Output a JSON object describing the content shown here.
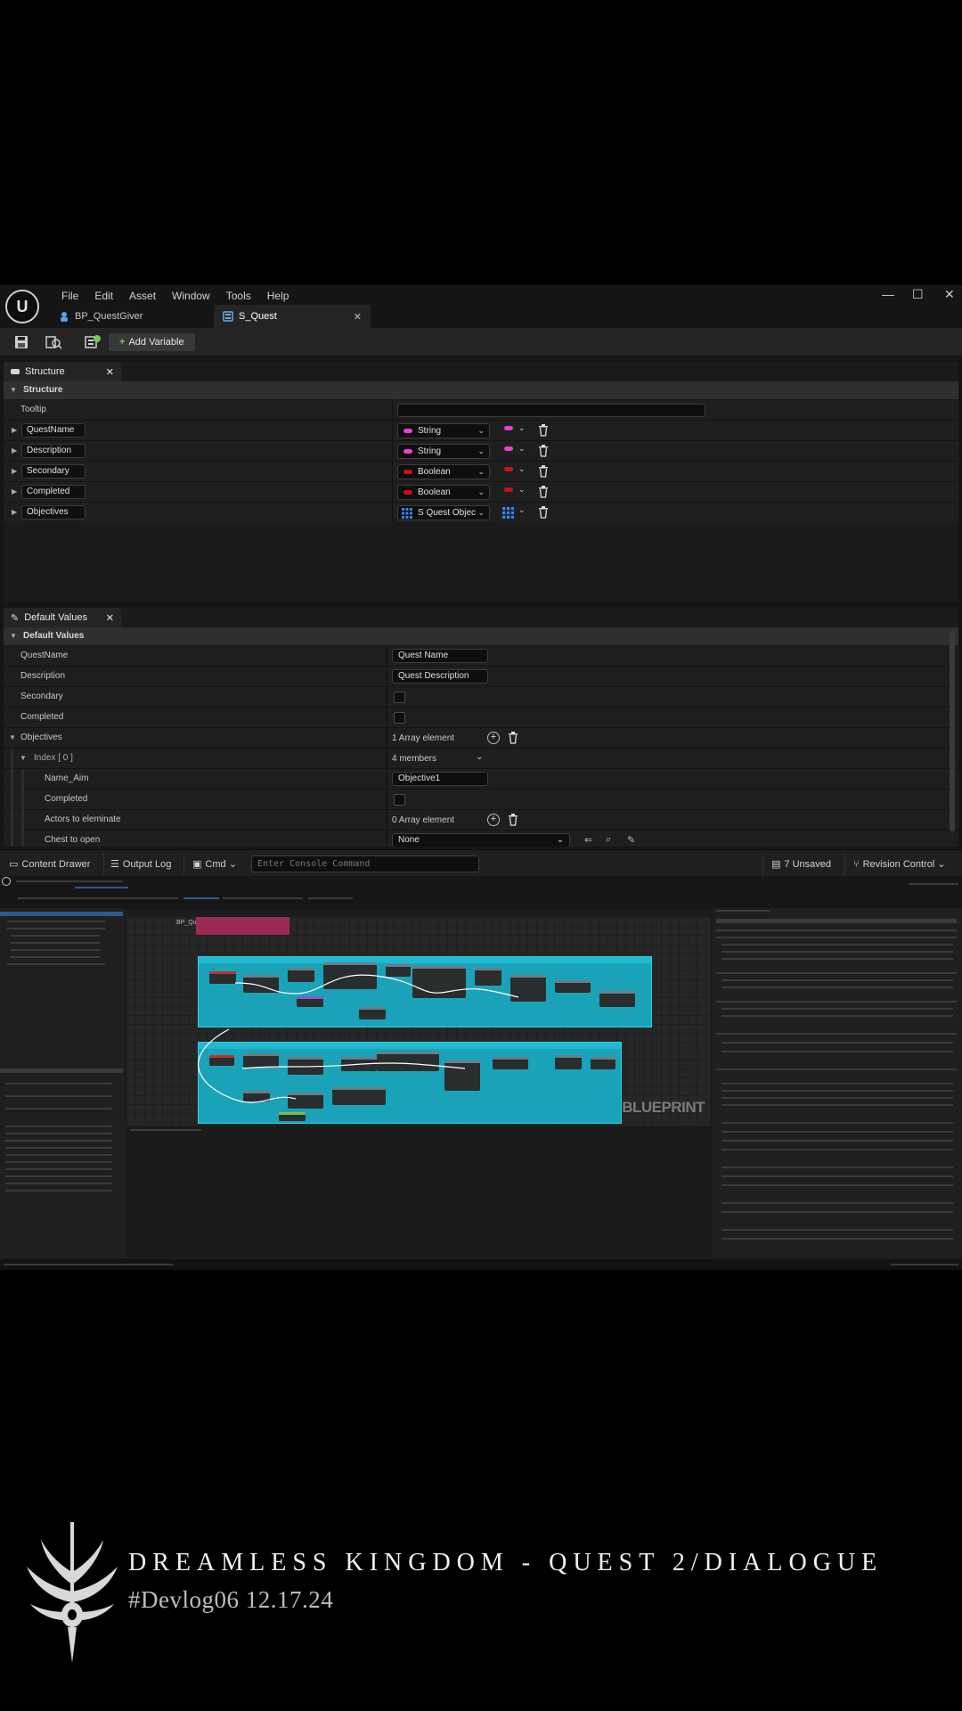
{
  "menu": [
    "File",
    "Edit",
    "Asset",
    "Window",
    "Tools",
    "Help"
  ],
  "tabs": [
    {
      "label": "BP_QuestGiver",
      "active": false
    },
    {
      "label": "S_Quest",
      "active": true
    }
  ],
  "toolbar": {
    "add_variable": "Add Variable"
  },
  "structure_panel": {
    "tab_label": "Structure",
    "section": "Structure",
    "tooltip_label": "Tooltip",
    "members": [
      {
        "name": "QuestName",
        "type": "String",
        "color": "#e53fd6"
      },
      {
        "name": "Description",
        "type": "String",
        "color": "#e53fd6"
      },
      {
        "name": "Secondary",
        "type": "Boolean",
        "color": "#c8101a"
      },
      {
        "name": "Completed",
        "type": "Boolean",
        "color": "#c8101a"
      },
      {
        "name": "Objectives",
        "type": "S Quest Objec",
        "color": "#3b82f6"
      }
    ]
  },
  "defaults_panel": {
    "tab_label": "Default Values",
    "section": "Default Values",
    "rows": {
      "quest_name": {
        "label": "QuestName",
        "value": "Quest Name"
      },
      "description": {
        "label": "Description",
        "value": "Quest Description"
      },
      "secondary": {
        "label": "Secondary"
      },
      "completed": {
        "label": "Completed"
      },
      "objectives": {
        "label": "Objectives",
        "value": "1 Array element"
      },
      "index": {
        "label": "Index [ 0 ]",
        "value": "4 members"
      },
      "name_aim": {
        "label": "Name_Aim",
        "value": "Objective1"
      },
      "obj_completed": {
        "label": "Completed"
      },
      "actors": {
        "label": "Actors to eleminate",
        "value": "0 Array element"
      },
      "chest": {
        "label": "Chest to open",
        "value": "None"
      }
    }
  },
  "statusbar": {
    "content_drawer": "Content Drawer",
    "output_log": "Output Log",
    "cmd": "Cmd",
    "console_placeholder": "Enter Console Command",
    "unsaved": "7 Unsaved",
    "revision_control": "Revision Control"
  },
  "blueprint": {
    "breadcrumb": "BP_QuestGiver  ›  EventGraph",
    "watermark": "BLUEPRINT"
  },
  "title_card": {
    "title": "DREAMLESS KINGDOM - QUEST 2/DIALOGUE",
    "subtitle": "#Devlog06 12.17.24"
  },
  "colors": {
    "string_pin": "#e53fd6",
    "boolean_pin": "#c8101a",
    "struct_pin": "#3b82f6",
    "comment_box": "#1aa3b8"
  }
}
